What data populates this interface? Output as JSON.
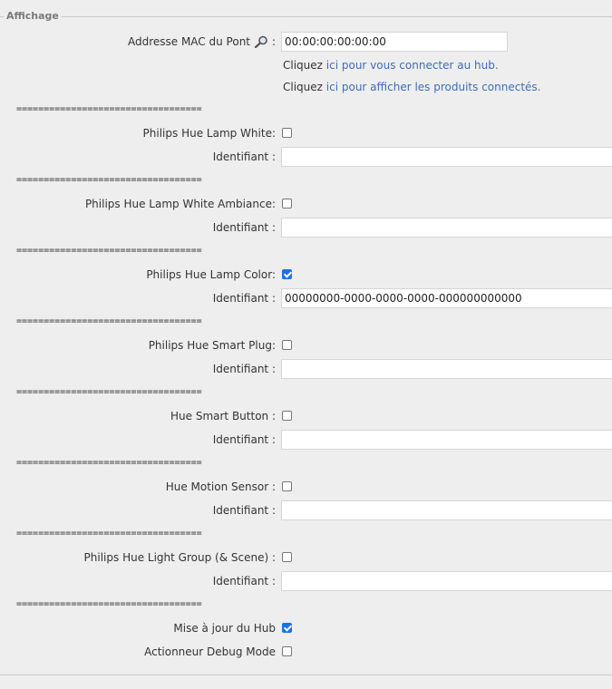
{
  "legend": "Affichage",
  "mac": {
    "label": "Addresse MAC du Pont",
    "suffix": ":",
    "value": "00:00:00:00:00:00"
  },
  "connect_line": {
    "prefix": "Cliquez",
    "link": "ici pour vous connecter au hub."
  },
  "products_line": {
    "prefix": "Cliquez",
    "link": "ici pour afficher les produits connectés."
  },
  "separator": "==================================",
  "identifier_label": "Identifiant :",
  "devices": [
    {
      "label": "Philips Hue Lamp White:",
      "checked": false,
      "identifier": ""
    },
    {
      "label": "Philips Hue Lamp White Ambiance:",
      "checked": false,
      "identifier": ""
    },
    {
      "label": "Philips Hue Lamp Color:",
      "checked": true,
      "identifier": "00000000-0000-0000-0000-000000000000"
    },
    {
      "label": "Philips Hue Smart Plug:",
      "checked": false,
      "identifier": ""
    },
    {
      "label": "Hue Smart Button :",
      "checked": false,
      "identifier": ""
    },
    {
      "label": "Hue Motion Sensor :",
      "checked": false,
      "identifier": ""
    },
    {
      "label": "Philips Hue Light Group (& Scene) :",
      "checked": false,
      "identifier": ""
    }
  ],
  "hub_update": {
    "label": "Mise à jour du Hub",
    "checked": true
  },
  "debug_mode": {
    "label": "Actionneur Debug Mode",
    "checked": false
  },
  "colors": {
    "checkbox_checked": "#1a73e8",
    "link": "#3c6eb4",
    "background": "#eeeeee"
  }
}
